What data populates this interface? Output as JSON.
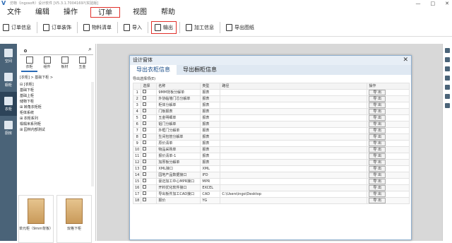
{
  "titlebar": {
    "logo": "V",
    "title": "仿物（ingosoft）设计软件 [V5.3.1.7004169?(实验版]",
    "controls": [
      "—",
      "□",
      "✕"
    ]
  },
  "menu": [
    "文件",
    "编辑",
    "操作",
    "订单",
    "视图",
    "帮助"
  ],
  "toolbar": [
    "订单信息",
    "订单装饰",
    "物料清单",
    "导入",
    "输出",
    "加工信息",
    "导出图纸"
  ],
  "leftbar": [
    "空间",
    "橱柜",
    "衣柜",
    "厨房"
  ],
  "panel": {
    "categories": [
      "衣柜",
      "组件",
      "板材",
      "五金"
    ],
    "breadcrumb": "[衣柜] > 基础下柜 >",
    "tree": [
      "⊟ [衣柜]",
      "   基础下柜",
      "   基础上柜",
      "   储物下柜",
      "⊞ 转角衣柜柜",
      "   柜体系统",
      "⊞ 衣柜系列",
      "   榻榻米系列柜",
      "⊞ 园林内部测试"
    ],
    "thumbs": [
      "单元柜（9mm背板）",
      "双格下柜",
      "",
      ""
    ]
  },
  "dialog": {
    "title": "设计窗体",
    "tabs": [
      "导出衣柜信息",
      "导出橱柜信息"
    ],
    "caption": "导出选择项(E)",
    "headers": [
      "",
      "选择",
      "名称",
      "类型",
      "路径",
      "操作"
    ],
    "rows": [
      {
        "idx": "1",
        "name": "9MM背板分解单",
        "type": "报表",
        "path": "",
        "action": "导 出"
      },
      {
        "idx": "2",
        "name": "外协临墙门芯分解单",
        "type": "报表",
        "path": "",
        "action": "导 出"
      },
      {
        "idx": "3",
        "name": "柜体分解单",
        "type": "报表",
        "path": "",
        "action": "导 出"
      },
      {
        "idx": "4",
        "name": "门板报表",
        "type": "报表",
        "path": "",
        "action": "导 出"
      },
      {
        "idx": "5",
        "name": "五金明细单",
        "type": "报表",
        "path": "",
        "action": "导 出"
      },
      {
        "idx": "6",
        "name": "铝门分解单",
        "type": "报表",
        "path": "",
        "action": "导 出"
      },
      {
        "idx": "7",
        "name": "外框门分解单",
        "type": "报表",
        "path": "",
        "action": "导 出"
      },
      {
        "idx": "8",
        "name": "生间包管分解单",
        "type": "报表",
        "path": "",
        "action": "导 出"
      },
      {
        "idx": "9",
        "name": "原价清单",
        "type": "报表",
        "path": "",
        "action": "导 出"
      },
      {
        "idx": "10",
        "name": "物品采购单",
        "type": "报表",
        "path": "",
        "action": "导 出"
      },
      {
        "idx": "11",
        "name": "报价清单-1",
        "type": "报表",
        "path": "",
        "action": "导 出"
      },
      {
        "idx": "12",
        "name": "加厚板分解单",
        "type": "报表",
        "path": "",
        "action": "导 出"
      },
      {
        "idx": "13",
        "name": "XML接口",
        "type": "XML",
        "path": "",
        "action": "导 出"
      },
      {
        "idx": "14",
        "name": "园地产品数据接口",
        "type": "IFD",
        "path": "",
        "action": "导 出"
      },
      {
        "idx": "15",
        "name": "豪迈加工中心MPR接口",
        "type": "MPR",
        "path": "",
        "action": "导 出"
      },
      {
        "idx": "16",
        "name": "开料优化软件接口",
        "type": "EXCEL",
        "path": "",
        "action": "导 出"
      },
      {
        "idx": "17",
        "name": "导出板件加工CAD接口",
        "type": "CAD",
        "path": "C:\\Users\\ingo\\Desktop",
        "action": "导 出"
      },
      {
        "idx": "18",
        "name": "报价",
        "type": "YG",
        "path": "",
        "action": "导 出"
      }
    ]
  }
}
